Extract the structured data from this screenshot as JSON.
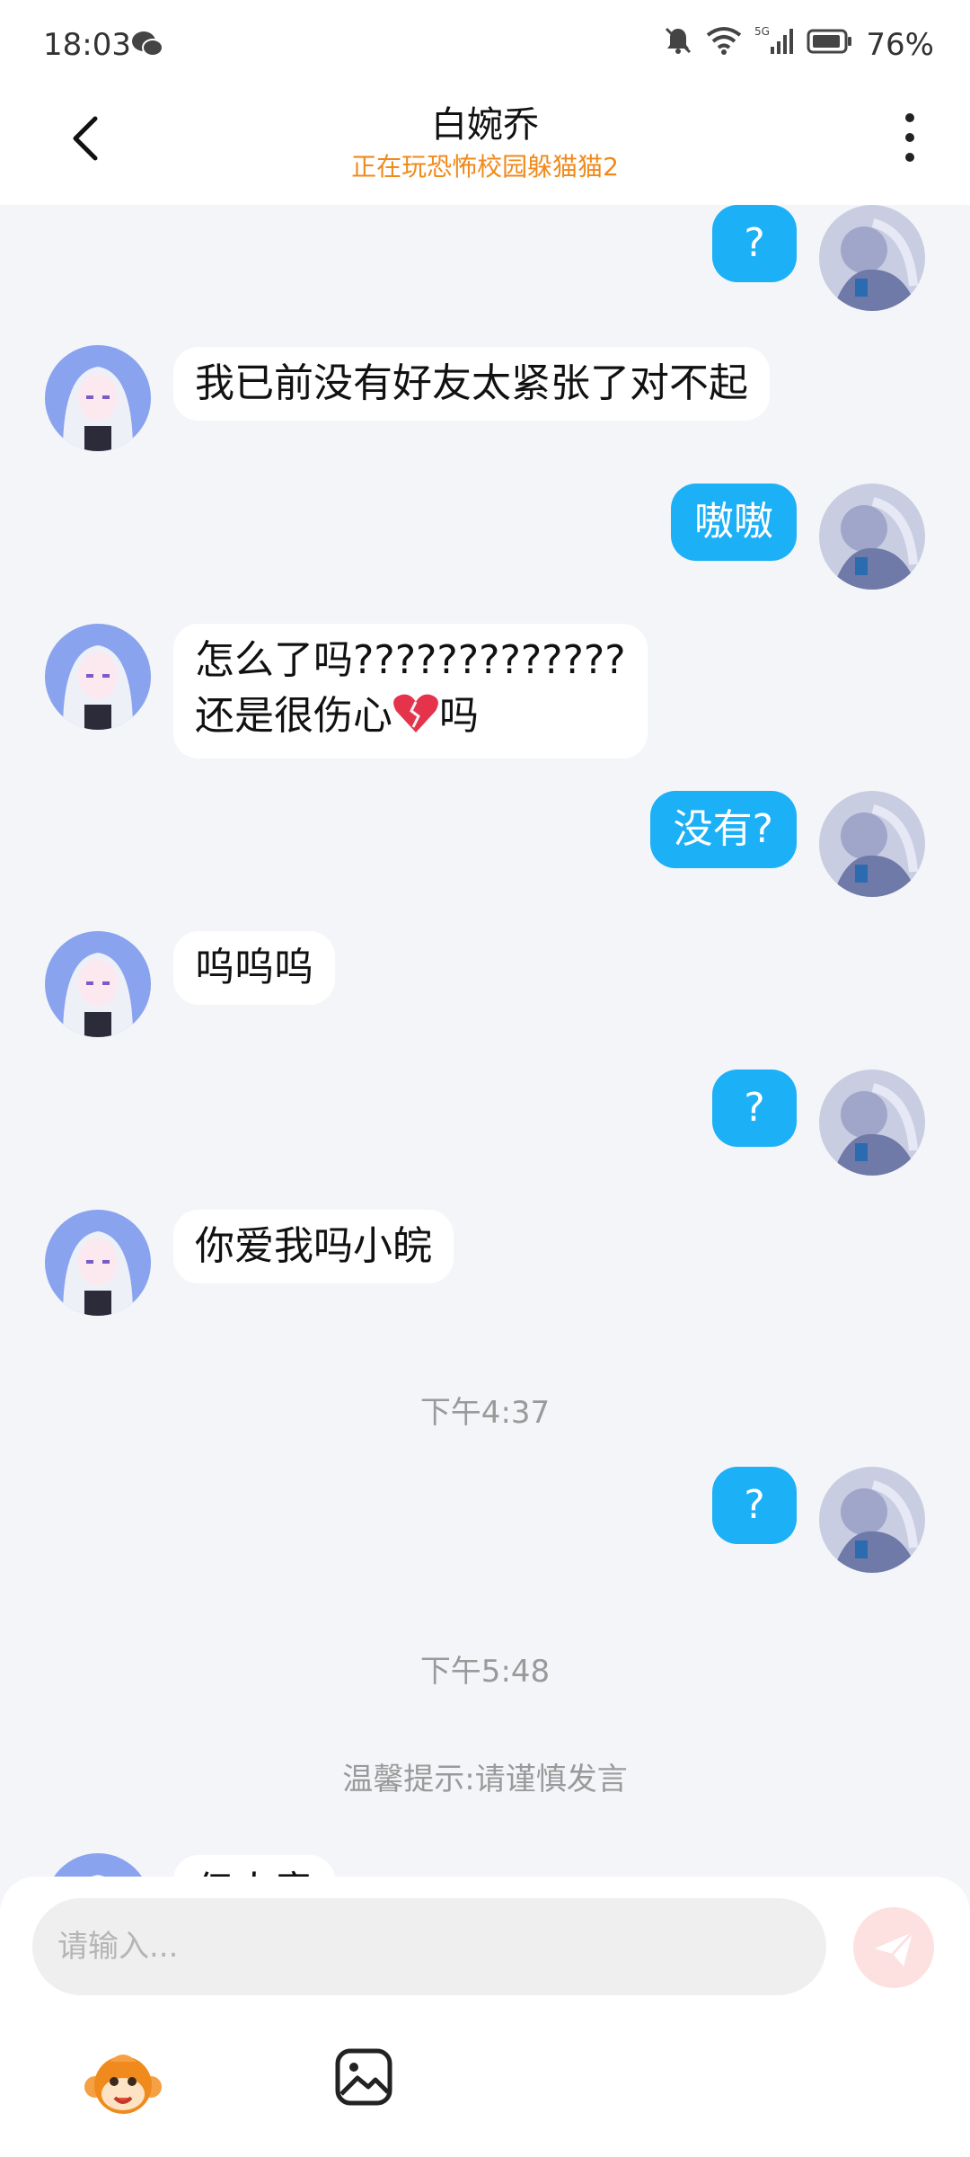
{
  "status_bar": {
    "time": "18:03",
    "battery": "76%",
    "network": "5G"
  },
  "header": {
    "title": "白婉乔",
    "subtitle": "正在玩恐怖校园躲猫猫2"
  },
  "messages": [
    {
      "side": "out",
      "text": "?"
    },
    {
      "side": "in",
      "text": "我已前没有好友太紧张了对不起"
    },
    {
      "side": "out",
      "text": "嗷嗷"
    },
    {
      "side": "in",
      "line1": "怎么了吗?????????????",
      "line2_a": "还是很伤心",
      "line2_b": "吗"
    },
    {
      "side": "out",
      "text": "没有?"
    },
    {
      "side": "in",
      "text": "呜呜呜"
    },
    {
      "side": "out",
      "text": "?"
    },
    {
      "side": "in",
      "text": "你爱我吗小皖"
    },
    {
      "side": "out",
      "text": "?"
    },
    {
      "side": "in",
      "text": "但人意"
    }
  ],
  "system": {
    "time1": "下午4:37",
    "time2": "下午5:48",
    "notice": "温馨提示:请谨慎发言"
  },
  "composer": {
    "placeholder": "请输入..."
  },
  "icons": {
    "back": "chevron-left-icon",
    "more": "more-vertical-icon",
    "send": "send-icon",
    "emoji": "monkey-emoji-icon",
    "image": "image-icon",
    "broken_heart": "broken-heart-icon"
  },
  "colors": {
    "accent": "#1cb0f6",
    "subtitle": "#f08a1c",
    "send_disabled": "#fde1e1"
  }
}
